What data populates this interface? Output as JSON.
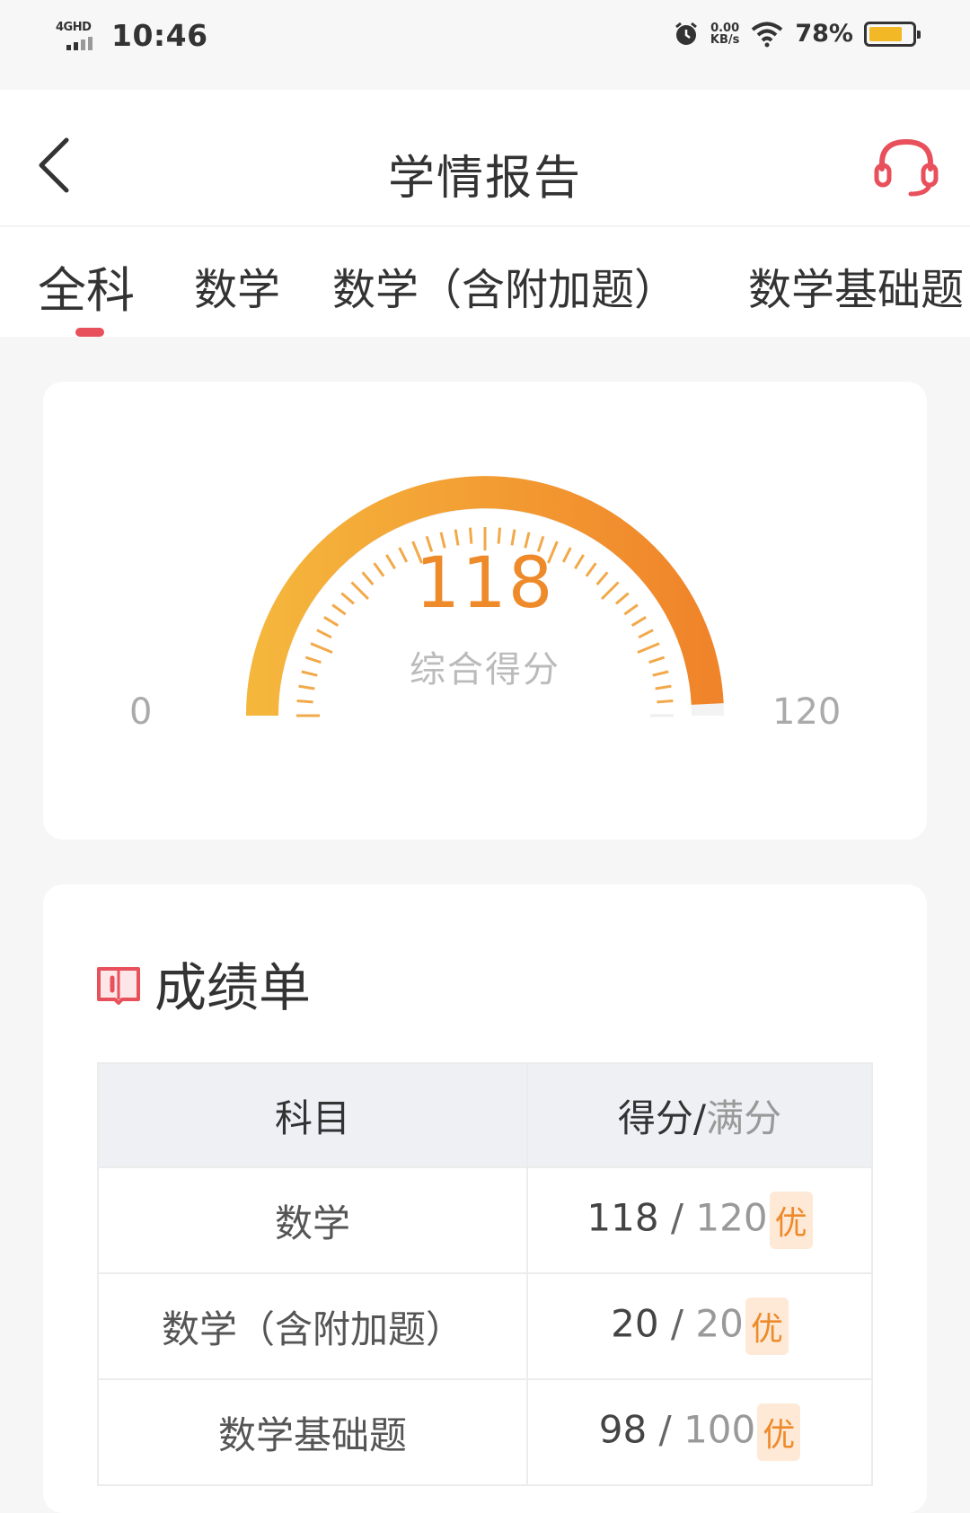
{
  "status": {
    "network": "4GHD",
    "time": "10:46",
    "speed_value": "0.00",
    "speed_unit": "KB/s",
    "battery_pct": "78%",
    "battery_level": 0.78
  },
  "navbar": {
    "title": "学情报告",
    "accent": "#e8505b"
  },
  "tabs": [
    "全科",
    "数学",
    "数学（含附加题）",
    "数学基础题"
  ],
  "tabs_active_index": 0,
  "gauge": {
    "score": "118",
    "label": "综合得分",
    "min": "0",
    "max": "120",
    "value": 118,
    "range": [
      0,
      120
    ],
    "colors": [
      "#f5b63c",
      "#f0842a"
    ]
  },
  "report": {
    "title": "成绩单",
    "headers": {
      "subject": "科目",
      "score": "得分/",
      "full": "满分"
    },
    "rows": [
      {
        "subject": "数学",
        "got": "118",
        "sep": " / ",
        "total": "120",
        "grade": "优"
      },
      {
        "subject": "数学（含附加题）",
        "got": "20",
        "sep": " / ",
        "total": "20",
        "grade": "优"
      },
      {
        "subject": "数学基础题",
        "got": "98",
        "sep": " / ",
        "total": "100",
        "grade": "优"
      }
    ]
  }
}
